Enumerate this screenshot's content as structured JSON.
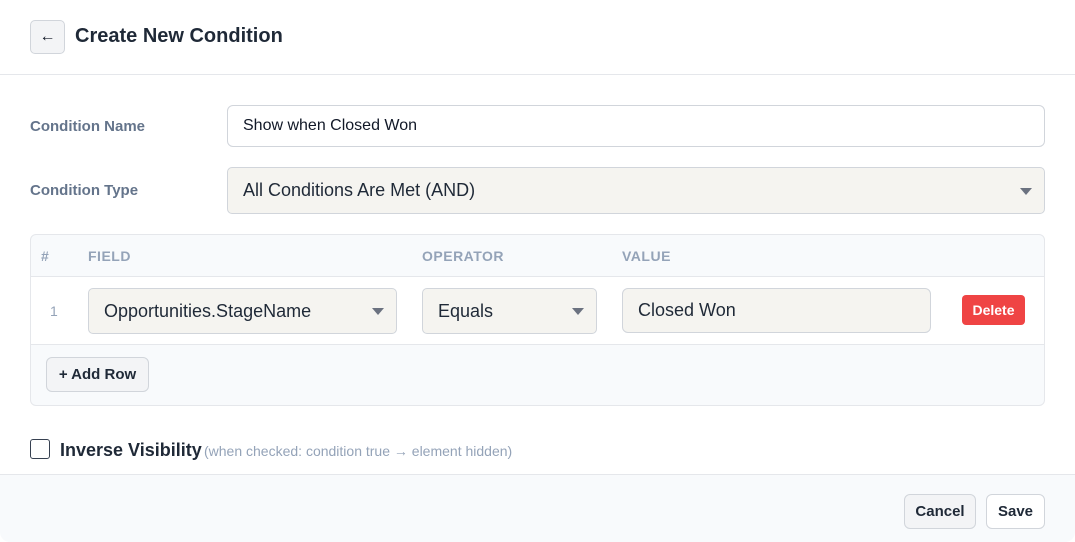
{
  "header": {
    "back_icon": "←",
    "title": "Create New Condition"
  },
  "form": {
    "condition_name_label": "Condition Name",
    "condition_name_value": "Show when Closed Won",
    "condition_type_label": "Condition Type",
    "condition_type_value": "All Conditions Are Met (AND)"
  },
  "table": {
    "columns": [
      "#",
      "FIELD",
      "OPERATOR",
      "VALUE"
    ],
    "rows": [
      {
        "num": "1",
        "field": "Opportunities.StageName",
        "operator": "Equals",
        "value": "Closed Won",
        "delete_label": "Delete"
      }
    ],
    "add_row_label": "+ Add Row"
  },
  "inverse": {
    "checked": false,
    "label": "Inverse Visibility",
    "hint": "(when checked: condition true → element hidden)"
  },
  "footer": {
    "cancel_label": "Cancel",
    "save_label": "Save"
  },
  "colors": {
    "delete": "#ef4444",
    "label": "#64748b",
    "muted": "#94a3b8"
  }
}
